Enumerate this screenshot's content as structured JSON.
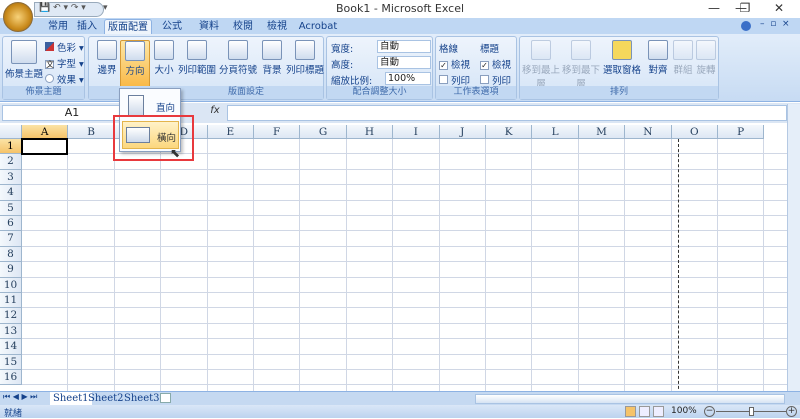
{
  "window": {
    "title": "Book1 - Microsoft Excel",
    "minimize": "—",
    "restore": "❐",
    "close": "✕"
  },
  "qat": {
    "save": "💾",
    "undo": "↶ ▾",
    "redo": "↷ ▾",
    "customize": "▾"
  },
  "tabs": [
    "常用",
    "插入",
    "版面配置",
    "公式",
    "資料",
    "校閱",
    "檢視",
    "Acrobat"
  ],
  "active_tab": "版面配置",
  "ribbon": {
    "themes": {
      "label": "佈景主題",
      "button": "佈景主題",
      "colors": "色彩 ▾",
      "fonts": "字型 ▾",
      "effects": "效果 ▾"
    },
    "page_setup": {
      "label": "版面設定",
      "buttons": [
        "邊界",
        "方向",
        "大小",
        "列印範圍",
        "分頁符號",
        "背景",
        "列印標題"
      ]
    },
    "scale": {
      "label": "配合調整大小",
      "width_label": "寬度:",
      "width_value": "自動",
      "height_label": "高度:",
      "height_value": "自動",
      "scale_label": "縮放比例:",
      "scale_value": "100%"
    },
    "sheet_options": {
      "label": "工作表選項",
      "gridlines": "格線",
      "headings": "標題",
      "view": "檢視",
      "print": "列印",
      "check": "✓"
    },
    "arrange": {
      "label": "排列",
      "bring_front": "移到最上層",
      "send_back": "移到最下層",
      "selection_pane": "選取窗格",
      "align": "對齊",
      "group": "群組",
      "rotate": "旋轉"
    }
  },
  "orientation_menu": {
    "portrait": "直向",
    "landscape": "橫向"
  },
  "formula_bar": {
    "name_box": "A1",
    "fx": "fx",
    "value": ""
  },
  "columns": [
    "A",
    "B",
    "C",
    "D",
    "E",
    "F",
    "G",
    "H",
    "I",
    "J",
    "K",
    "L",
    "M",
    "N",
    "O",
    "P"
  ],
  "rows": [
    "1",
    "2",
    "3",
    "4",
    "5",
    "6",
    "7",
    "8",
    "9",
    "10",
    "11",
    "12",
    "13",
    "14",
    "15",
    "16"
  ],
  "selected_cell": "A1",
  "sheets": [
    "Sheet1",
    "Sheet2",
    "Sheet3"
  ],
  "active_sheet": "Sheet1",
  "status": {
    "text": "就緒",
    "zoom": "100%"
  }
}
